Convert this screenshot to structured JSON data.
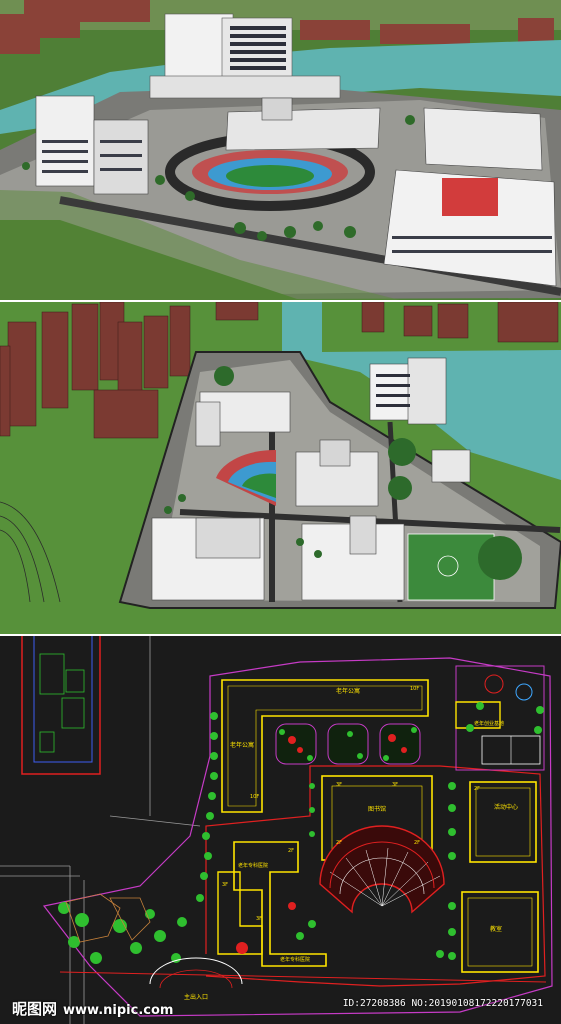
{
  "plan": {
    "labels": {
      "senior_apartment_top": "老年公寓",
      "floor_10f_top": "10F",
      "senior_apartment_left": "老年公寓",
      "floor_10f_left": "10F",
      "startup_base": "老年创业基地",
      "library": "图书馆",
      "floor_3f_a": "3F",
      "floor_3f_b": "3F",
      "floor_2f_a": "2F",
      "floor_2f_b": "2F",
      "floor_2f_c": "2F",
      "activity_center": "活动中心",
      "geriatric_hospital_top": "老年专科医院",
      "geriatric_hospital_bottom": "老年专科医院",
      "floor_3f_c": "3F",
      "floor_2f_d": "2F",
      "floor_3f_d": "3F",
      "classroom": "教室",
      "main_entrance": "主出入口"
    }
  },
  "watermark": {
    "logo": "昵图网",
    "site": "www.nipic.com",
    "id_line": "ID:27208386 NO:20190108172220177031"
  },
  "colors": {
    "water": "#5fb3b0",
    "grass": "#4c7a34",
    "cad_bg": "#1b1b1b",
    "cad_yellow": "#ffe400",
    "cad_magenta": "#c63bc6",
    "cad_red": "#e02020",
    "cad_green": "#2fbf2f"
  }
}
